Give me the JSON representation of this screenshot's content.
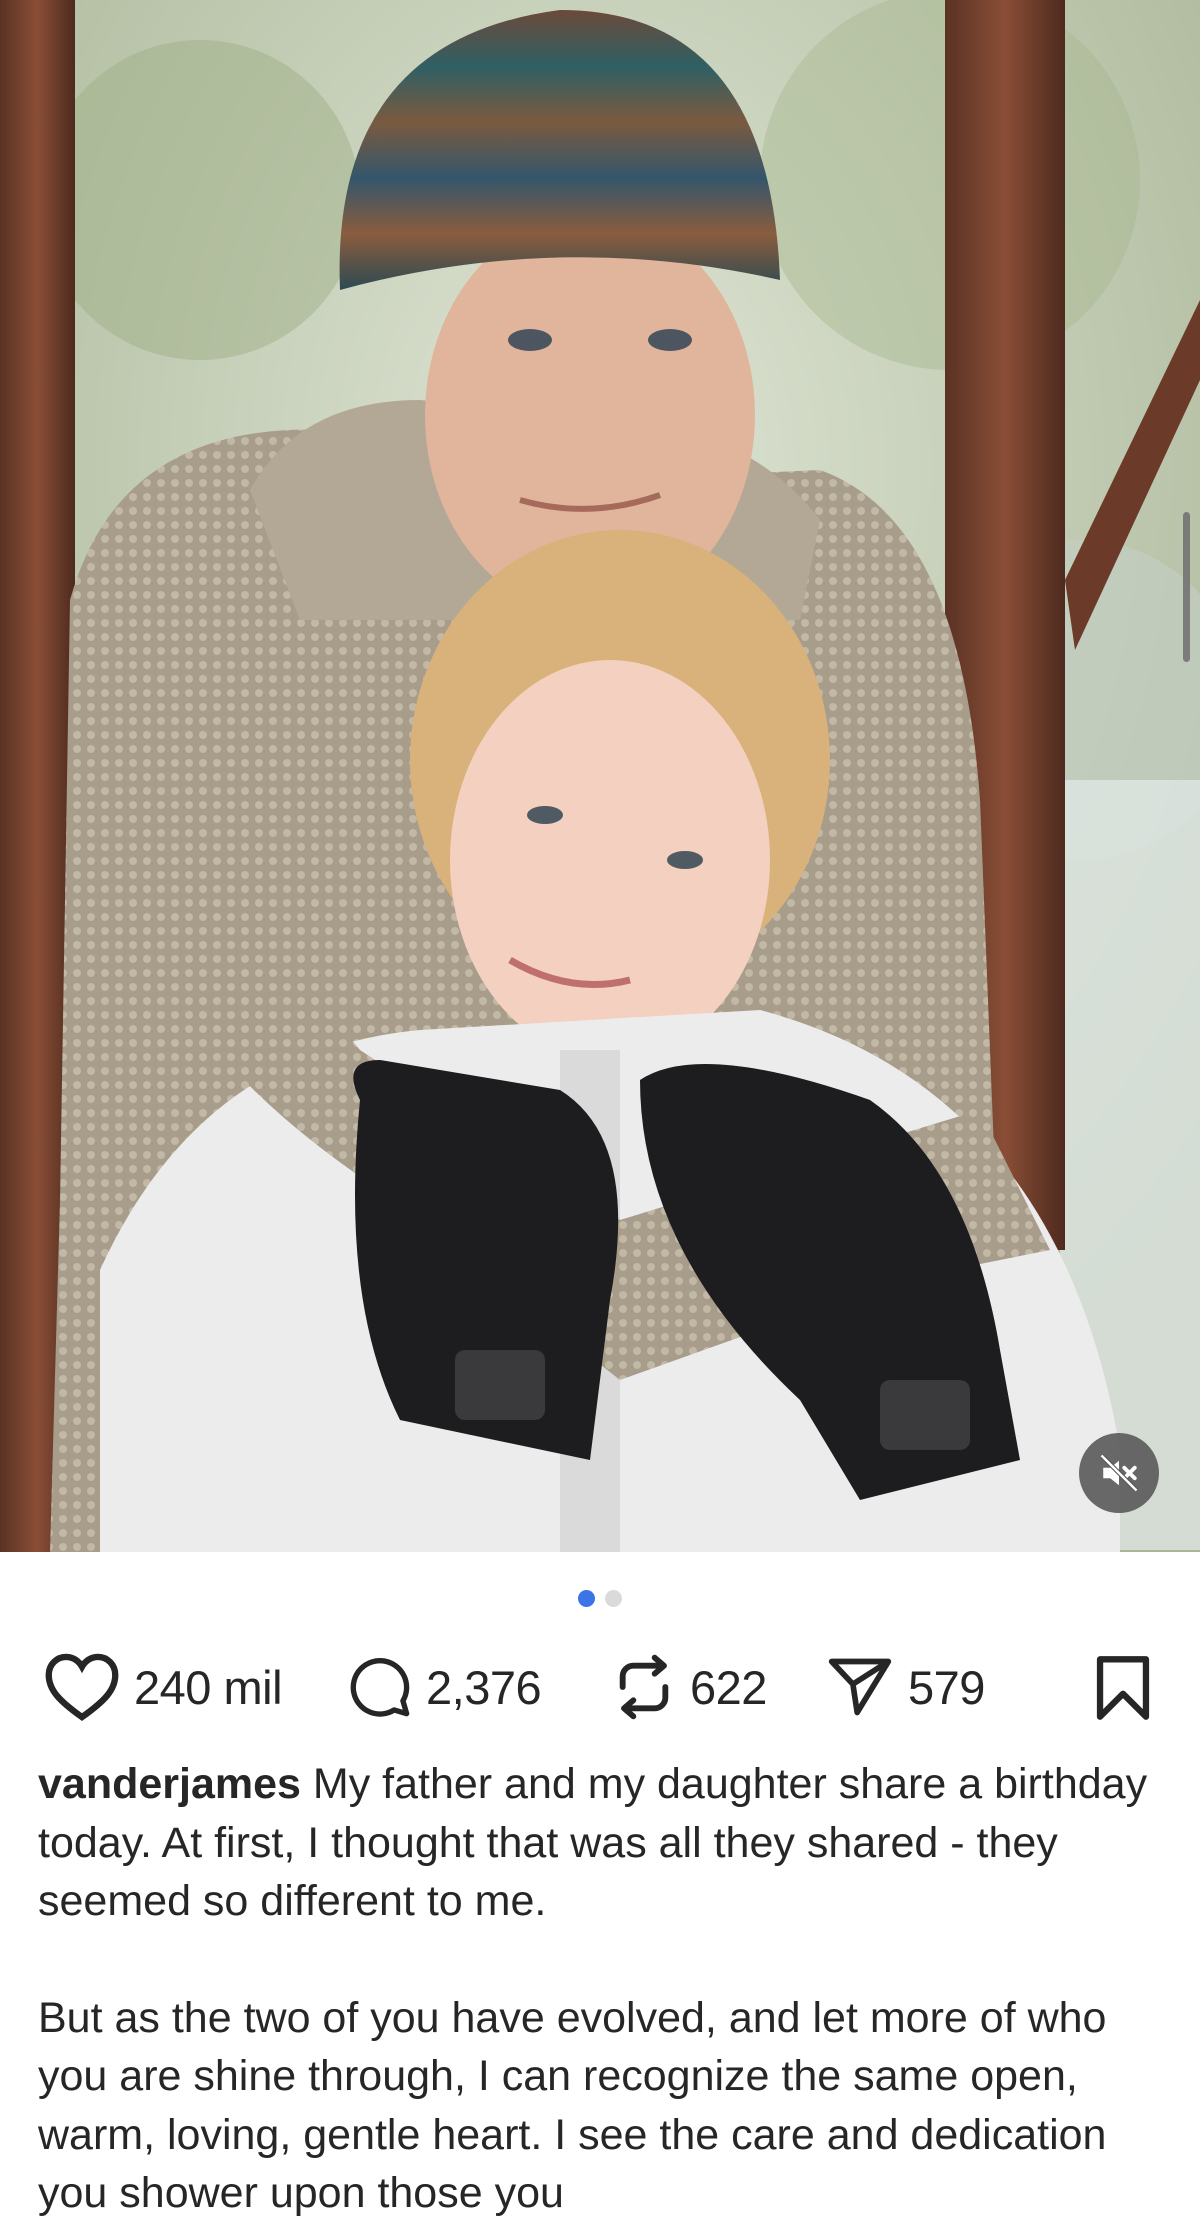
{
  "post": {
    "media": {
      "description_icon": "photo",
      "mute_icon": "speaker-muted-icon",
      "slide_count": 2,
      "active_slide": 1
    },
    "actions": {
      "likes": "240 mil",
      "comments": "2,376",
      "reposts": "622",
      "shares": "579"
    },
    "caption": {
      "username": "vanderjames",
      "paragraph1": "My father and my daughter share a birthday today.  At first, I thought that was all they shared - they seemed so different to me.",
      "paragraph2": "But as the two of you have evolved, and let more of who you are shine through, I can recognize the same open, warm, loving, gentle heart.  I see the care and dedication you shower upon those you"
    }
  },
  "colors": {
    "accent": "#3b74e8",
    "text": "#262626",
    "dot_inactive": "#d9dadb"
  }
}
